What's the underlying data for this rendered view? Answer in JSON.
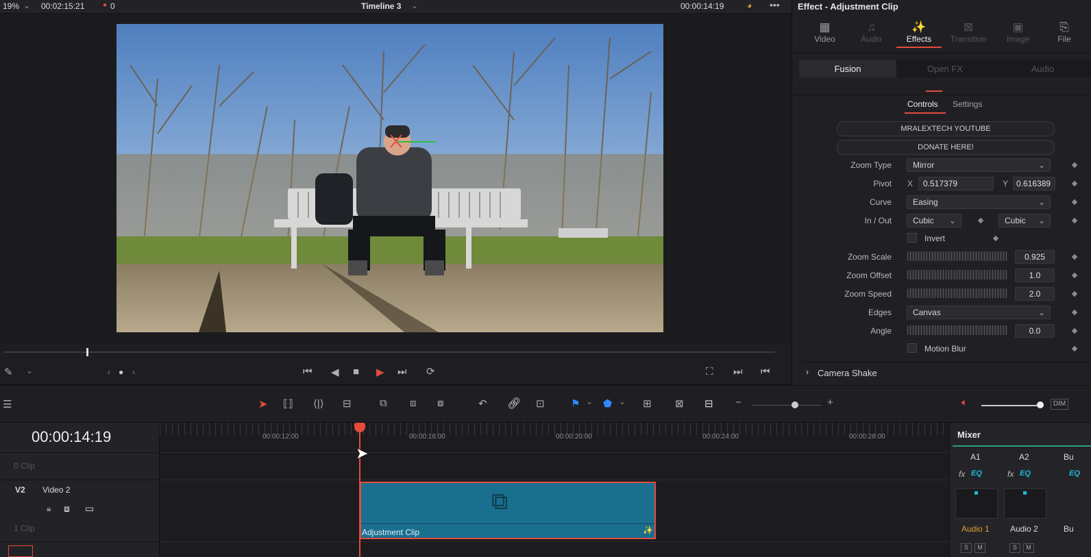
{
  "topbar": {
    "zoom": "19%",
    "source_timecode": "00:02:15:21",
    "markers": "0",
    "timeline_name": "Timeline 3",
    "record_timecode": "00:00:14:19"
  },
  "inspector": {
    "title": "Effect - Adjustment Clip",
    "tabs": [
      {
        "label": "Video",
        "icon": "film-icon"
      },
      {
        "label": "Audio",
        "icon": "music-note-icon"
      },
      {
        "label": "Effects",
        "icon": "magic-wand-icon"
      },
      {
        "label": "Transition",
        "icon": "transition-icon"
      },
      {
        "label": "Image",
        "icon": "image-icon"
      },
      {
        "label": "File",
        "icon": "file-icon"
      }
    ],
    "subtabs": [
      "Fusion",
      "Open FX",
      "Audio"
    ],
    "control_tabs": [
      "Controls",
      "Settings"
    ],
    "buttons": [
      "MRALEXTECH YOUTUBE",
      "DONATE HERE!"
    ],
    "zoom_type": {
      "label": "Zoom Type",
      "value": "Mirror"
    },
    "pivot": {
      "label": "Pivot",
      "x_label": "X",
      "x": "0.517379",
      "y_label": "Y",
      "y": "0.616389"
    },
    "curve": {
      "label": "Curve",
      "value": "Easing"
    },
    "in_out": {
      "label": "In / Out",
      "in": "Cubic",
      "out": "Cubic"
    },
    "invert": {
      "label": "Invert",
      "checked": false
    },
    "zoom_scale": {
      "label": "Zoom Scale",
      "value": "0.925"
    },
    "zoom_offset": {
      "label": "Zoom Offset",
      "value": "1.0"
    },
    "zoom_speed": {
      "label": "Zoom Speed",
      "value": "2.0"
    },
    "edges": {
      "label": "Edges",
      "value": "Canvas"
    },
    "angle": {
      "label": "Angle",
      "value": "0.0"
    },
    "motion_blur": {
      "label": "Motion Blur",
      "checked": false
    },
    "camera_shake": "Camera Shake"
  },
  "timeline": {
    "timecode": "00:00:14:19",
    "ruler": [
      "00:00:12:00",
      "00:00:16:00",
      "00:00:20:00",
      "00:00:24:00",
      "00:00:28:00"
    ],
    "track_top_info": "0 Clip",
    "track": {
      "id": "V2",
      "name": "Video 2",
      "clip_count": "1 Clip"
    },
    "clip_name": "Adjustment Clip",
    "dim": "DIM"
  },
  "mixer": {
    "title": "Mixer",
    "channels": [
      "A1",
      "A2",
      "Bu"
    ],
    "fx": "fx",
    "eq": "EQ",
    "names": [
      "Audio 1",
      "Audio 2",
      "Bu"
    ],
    "solo": "S",
    "mute": "M"
  },
  "colors": {
    "accent_red": "#e64b3c",
    "clip_blue": "#1a6f8f",
    "eq_cyan": "#1fb8d6",
    "audio_name_orange": "#e0a030"
  }
}
